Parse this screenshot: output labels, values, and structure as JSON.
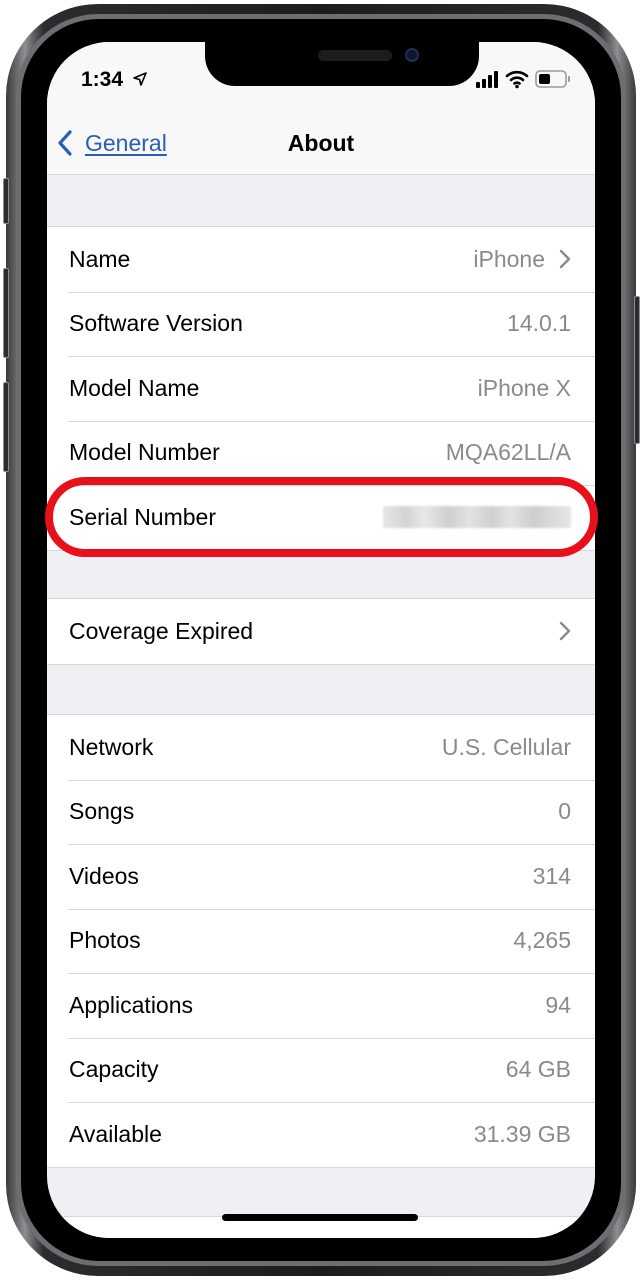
{
  "status_bar": {
    "time": "1:34",
    "icons": [
      "location-arrow-icon",
      "cellular-signal-icon",
      "wifi-icon",
      "battery-icon"
    ]
  },
  "nav": {
    "back_label": "General",
    "title": "About"
  },
  "groups": [
    {
      "rows": [
        {
          "label": "Name",
          "value": "iPhone",
          "chevron": true
        },
        {
          "label": "Software Version",
          "value": "14.0.1"
        },
        {
          "label": "Model Name",
          "value": "iPhone X"
        },
        {
          "label": "Model Number",
          "value": "MQA62LL/A"
        },
        {
          "label": "Serial Number",
          "value": "",
          "value_blurred": true,
          "highlighted": true
        }
      ]
    },
    {
      "rows": [
        {
          "label": "Coverage Expired",
          "value": "",
          "chevron": true
        }
      ]
    },
    {
      "rows": [
        {
          "label": "Network",
          "value": "U.S. Cellular"
        },
        {
          "label": "Songs",
          "value": "0"
        },
        {
          "label": "Videos",
          "value": "314"
        },
        {
          "label": "Photos",
          "value": "4,265"
        },
        {
          "label": "Applications",
          "value": "94"
        },
        {
          "label": "Capacity",
          "value": "64 GB"
        },
        {
          "label": "Available",
          "value": "31.39 GB"
        }
      ]
    }
  ],
  "colors": {
    "accent": "#2a5db8",
    "highlight": "#e8101a",
    "grouped_background": "#efeff4",
    "secondary_text": "#8a8a8e"
  }
}
